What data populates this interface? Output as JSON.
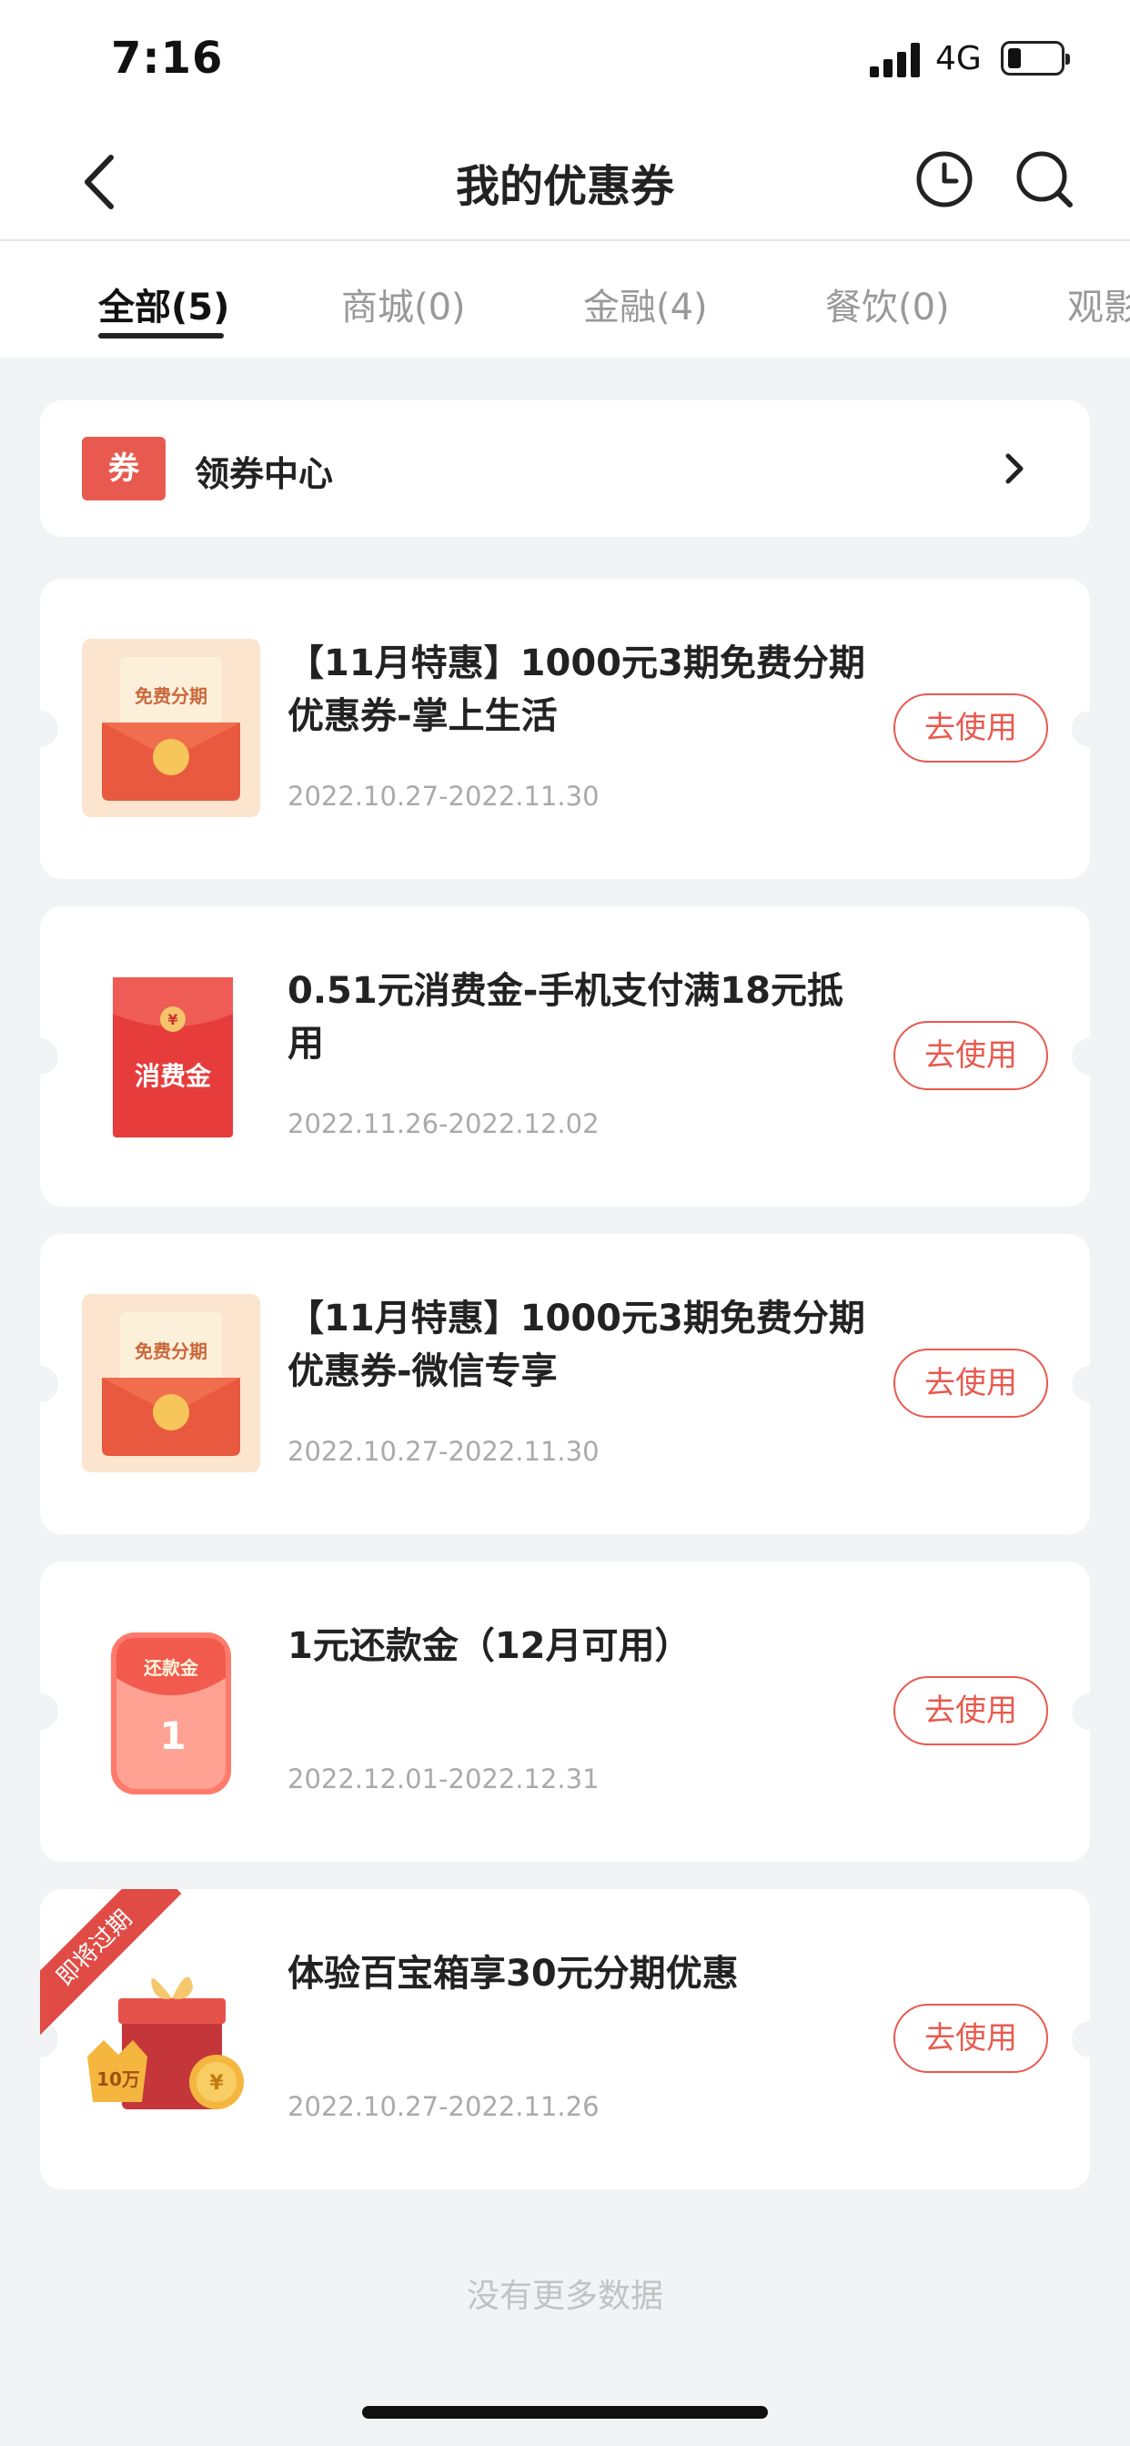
{
  "status": {
    "time": "7:16",
    "network": "4G"
  },
  "header": {
    "title": "我的优惠券"
  },
  "tabs": [
    "全部(5)",
    "商城(0)",
    "金融(4)",
    "餐饮(0)",
    "观影"
  ],
  "coupon_center": {
    "badge": "券",
    "label": "领券中心"
  },
  "coupons": [
    {
      "image_label": "免费分期",
      "title": "【11月特惠】1000元3期免费分期优惠券-掌上生活",
      "date": "2022.10.27-2022.11.30",
      "button": "去使用"
    },
    {
      "image_label": "消费金",
      "title": "0.51元消费金-手机支付满18元抵用",
      "date": "2022.11.26-2022.12.02",
      "button": "去使用"
    },
    {
      "image_label": "免费分期",
      "title": "【11月特惠】1000元3期免费分期优惠券-微信专享",
      "date": "2022.10.27-2022.11.30",
      "button": "去使用"
    },
    {
      "image_label": "还款金",
      "title": "1元还款金（12月可用）",
      "date": "2022.12.01-2022.12.31",
      "button": "去使用"
    },
    {
      "image_label": "10万",
      "ribbon": "即将过期",
      "title": "体验百宝箱享30元分期优惠",
      "date": "2022.10.27-2022.11.26",
      "button": "去使用"
    }
  ],
  "footer": "没有更多数据",
  "colors": {
    "accent": "#e85a4f",
    "background": "#f2f3f5"
  }
}
